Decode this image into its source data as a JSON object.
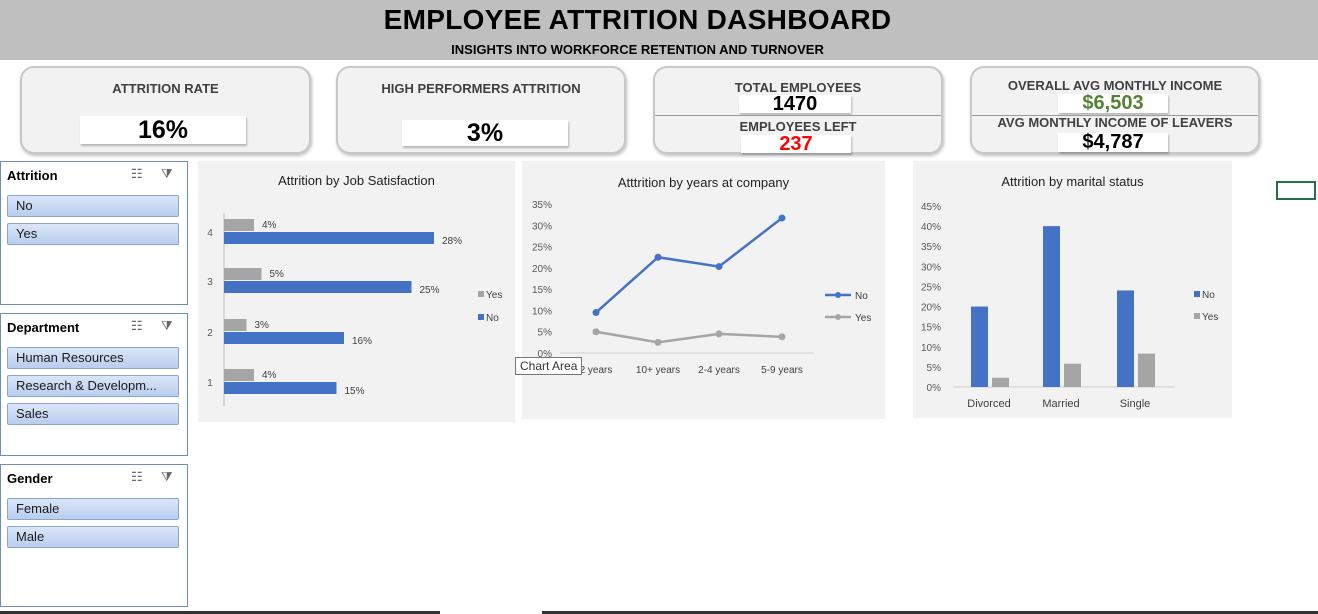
{
  "header": {
    "title": "EMPLOYEE ATTRITION DASHBOARD",
    "subtitle": "INSIGHTS INTO WORKFORCE RETENTION AND TURNOVER"
  },
  "kpis": {
    "attrition_rate": {
      "label": "ATTRITION RATE",
      "value": "16%"
    },
    "high_performers": {
      "label": "HIGH PERFORMERS ATTRITION",
      "value": "3%"
    },
    "total_employees": {
      "label": "TOTAL EMPLOYEES",
      "value": "1470"
    },
    "employees_left": {
      "label": "EMPLOYEES LEFT",
      "value": "237"
    },
    "overall_income": {
      "label": "OVERALL AVG MONTHLY INCOME",
      "value": "$6,503"
    },
    "leavers_income": {
      "label": "AVG MONTHLY INCOME OF LEAVERS",
      "value": "$4,787"
    }
  },
  "colors": {
    "blue": "#4472c4",
    "gray": "#a5a5a5",
    "green": "#548235",
    "red": "#ff0000"
  },
  "slicers": {
    "attrition": {
      "title": "Attrition",
      "items": [
        "No",
        "Yes"
      ]
    },
    "department": {
      "title": "Department",
      "items": [
        "Human Resources",
        "Research & Developm...",
        "Sales"
      ]
    },
    "gender": {
      "title": "Gender",
      "items": [
        "Female",
        "Male"
      ]
    },
    "icons": {
      "multiselect": "multi-select-icon",
      "clear": "clear-filter-icon"
    }
  },
  "tooltip": "Chart Area",
  "chart_data": [
    {
      "type": "bar",
      "orientation": "horizontal",
      "title": "Attrition by Job Satisfaction",
      "categories": [
        "1",
        "2",
        "3",
        "4"
      ],
      "series": [
        {
          "name": "Yes",
          "values": [
            4,
            3,
            5,
            4
          ],
          "labels": [
            "4%",
            "3%",
            "5%",
            "4%"
          ]
        },
        {
          "name": "No",
          "values": [
            15,
            16,
            25,
            28
          ],
          "labels": [
            "15%",
            "16%",
            "25%",
            "28%"
          ]
        }
      ],
      "legend": "right",
      "grid": false
    },
    {
      "type": "line",
      "title": "Atttrition by years at company",
      "categories": [
        "0-2 years",
        "10+ years",
        "2-4 years",
        "5-9 years"
      ],
      "tick_labels_visible": [
        "2 years",
        "10+ years",
        "2-4 years",
        "5-9 years"
      ],
      "y_ticks": [
        "0%",
        "5%",
        "10%",
        "15%",
        "20%",
        "25%",
        "30%",
        "35%"
      ],
      "ylim": [
        0,
        35
      ],
      "series": [
        {
          "name": "No",
          "values": [
            9.5,
            22.5,
            20.3,
            31.7
          ]
        },
        {
          "name": "Yes",
          "values": [
            5,
            2.5,
            4.5,
            3.8
          ]
        }
      ],
      "legend": "right",
      "grid": false
    },
    {
      "type": "bar",
      "orientation": "vertical",
      "title": "Attrition by marital status",
      "categories": [
        "Divorced",
        "Married",
        "Single"
      ],
      "y_ticks": [
        "0%",
        "5%",
        "10%",
        "15%",
        "20%",
        "25%",
        "30%",
        "35%",
        "40%",
        "45%"
      ],
      "ylim": [
        0,
        45
      ],
      "series": [
        {
          "name": "No",
          "values": [
            20,
            40,
            24
          ]
        },
        {
          "name": "Yes",
          "values": [
            2.3,
            5.8,
            8.3
          ]
        }
      ],
      "legend": "right",
      "grid": false
    }
  ]
}
